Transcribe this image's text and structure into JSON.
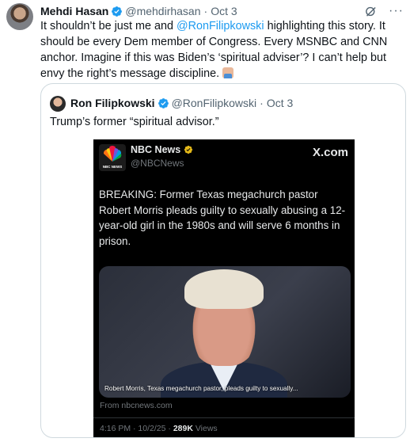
{
  "tweet": {
    "author_name": "Mehdi Hasan",
    "author_handle": "@mehdirhasan",
    "separator": "·",
    "date": "Oct 3",
    "more": "···",
    "text_1": "It shouldn’t be just me and ",
    "mention": "@RonFilipkowski",
    "text_2": " highlighting this story. It should be every Dem member of Congress. Every MSNBC and CNN anchor. Imagine if this was Biden’s ‘spiritual adviser’? I can’t help but envy the right’s message discipline. "
  },
  "quote": {
    "author_name": "Ron Filipkowski",
    "author_handle": "@RonFilipkowski",
    "separator": "·",
    "date": "Oct 3",
    "text": "Trump’s former “spiritual advisor.”"
  },
  "embedded": {
    "source_name": "NBC News",
    "source_handle": "@NBCNews",
    "logo_label": "NBC NEWS",
    "brand": "X.com",
    "headline": "BREAKING: Former Texas megachurch pastor Robert Morris pleads guilty to sexually abusing a 12-year-old girl in the 1980s and will serve 6 months in prison.",
    "card_caption": "Robert Morris, Texas megachurch pastor, pleads guilty to sexually...",
    "card_source": "From nbcnews.com",
    "time_date": "4:16 PM · 10/2/25 · ",
    "views_count": "289K",
    "views_label": " Views"
  },
  "colors": {
    "accent": "#1d9bf0",
    "text": "#0f1419",
    "muted": "#536471",
    "verified_gold": "#e2b719"
  },
  "icons": [
    "verified-badge-icon",
    "grok-icon",
    "more-icon",
    "person-facepalm-emoji"
  ]
}
